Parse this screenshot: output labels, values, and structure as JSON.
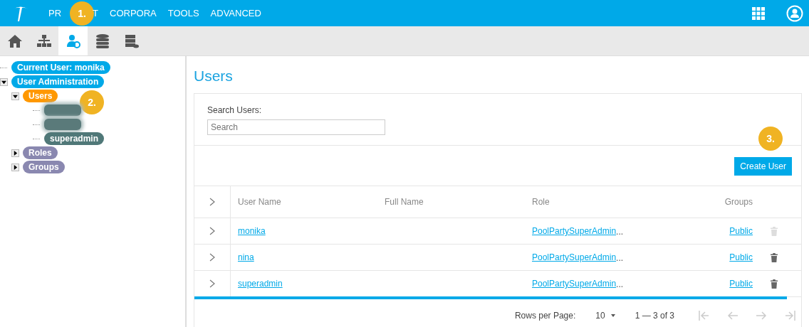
{
  "top_nav": {
    "menu": [
      {
        "label": "PR",
        "label_end": "T"
      },
      {
        "label": "CORPORA"
      },
      {
        "label": "TOOLS"
      },
      {
        "label": "ADVANCED"
      }
    ]
  },
  "toolbar": [
    {
      "kind": "home",
      "selected": false
    },
    {
      "kind": "hierarchy",
      "selected": false
    },
    {
      "kind": "users",
      "selected": true
    },
    {
      "kind": "database",
      "selected": false
    },
    {
      "kind": "server",
      "selected": false
    }
  ],
  "tree": [
    {
      "label": "Current User: monika",
      "color": "#00a9e8"
    },
    {
      "label": "User Administration",
      "color": "#00a9e8",
      "expanded": true,
      "children": [
        {
          "label": "Users",
          "color": "#ff9800",
          "expanded": true,
          "children": [
            {
              "kind": "blurred",
              "color": "#5a7a7a"
            },
            {
              "kind": "blurred",
              "color": "#5a7a7a"
            },
            {
              "label": "superadmin",
              "color": "#507878"
            }
          ]
        },
        {
          "label": "Roles",
          "color": "#8a88b0",
          "expanded": false
        },
        {
          "label": "Groups",
          "color": "#8a88b0",
          "expanded": false
        }
      ]
    }
  ],
  "callouts": [
    "1.",
    "2.",
    "3."
  ],
  "page_title": "Users",
  "search": {
    "label": "Search Users:",
    "placeholder": "Search"
  },
  "create_button": "Create User",
  "table": {
    "columns": [
      "User Name",
      "Full Name",
      "Role",
      "Groups"
    ],
    "rows": [
      {
        "user": "monika",
        "role": "PoolPartySuperAdmin",
        "more": "...",
        "groups": "Public",
        "delete_disabled": true
      },
      {
        "user": "nina",
        "role": "PoolPartySuperAdmin",
        "more": "...",
        "groups": "Public",
        "delete_disabled": false
      },
      {
        "user": "superadmin",
        "role": "PoolPartySuperAdmin",
        "more": "...",
        "groups": "Public",
        "delete_disabled": false
      }
    ]
  },
  "pagination": {
    "rows_label": "Rows per Page:",
    "rows_value": "10",
    "range": "1 — 3 of 3"
  }
}
